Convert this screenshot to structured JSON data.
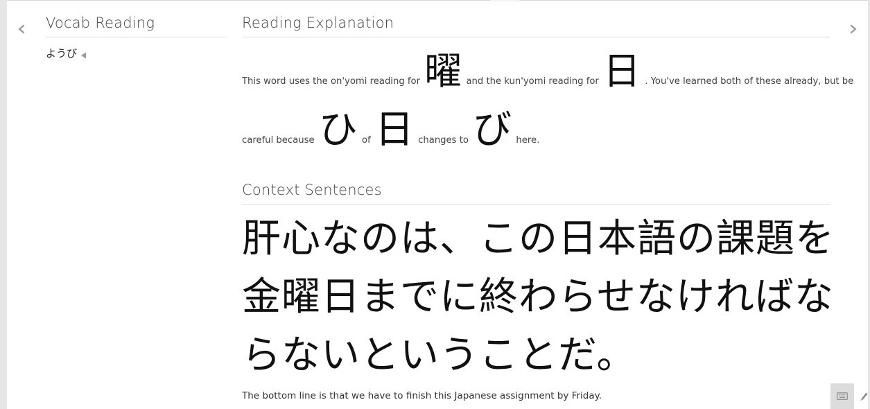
{
  "nav": {
    "prev_icon": "chevron-left-icon",
    "next_icon": "chevron-right-icon"
  },
  "vocab_reading": {
    "title": "Vocab Reading",
    "reading": "ようび",
    "audio_icon": "speaker-icon"
  },
  "reading_explanation": {
    "title": "Reading Explanation",
    "line1": [
      {
        "kind": "text",
        "value": "This word uses the on'yomi reading for"
      },
      {
        "kind": "kanji",
        "value": "曜"
      },
      {
        "kind": "text",
        "value": "and the kun'yomi reading for"
      },
      {
        "kind": "kanji",
        "value": "日"
      },
      {
        "kind": "text",
        "value": ". You've learned both of these already, but be"
      }
    ],
    "line2": [
      {
        "kind": "text",
        "value": "careful because"
      },
      {
        "kind": "kanji",
        "value": "ひ"
      },
      {
        "kind": "text",
        "value": "of"
      },
      {
        "kind": "kanji",
        "value": "日"
      },
      {
        "kind": "text",
        "value": "changes to"
      },
      {
        "kind": "kanji",
        "value": "び"
      },
      {
        "kind": "text",
        "value": "here."
      }
    ]
  },
  "context_sentences": {
    "title": "Context Sentences",
    "japanese_lines": [
      "肝心なのは、この日本語の課題を",
      "金曜日までに終わらせなければな",
      "らないということだ。"
    ],
    "english": "The bottom line is that we have to finish this Japanese assignment by Friday."
  },
  "footer": {
    "keyboard_icon": "keyboard-icon",
    "pencil_icon": "pencil-icon"
  },
  "colors": {
    "gutter": "#e6e6e6",
    "rule": "#dedede",
    "heading": "#444444",
    "body_text": "#222222",
    "keyboard_button_bg": "#dcdcdc"
  }
}
